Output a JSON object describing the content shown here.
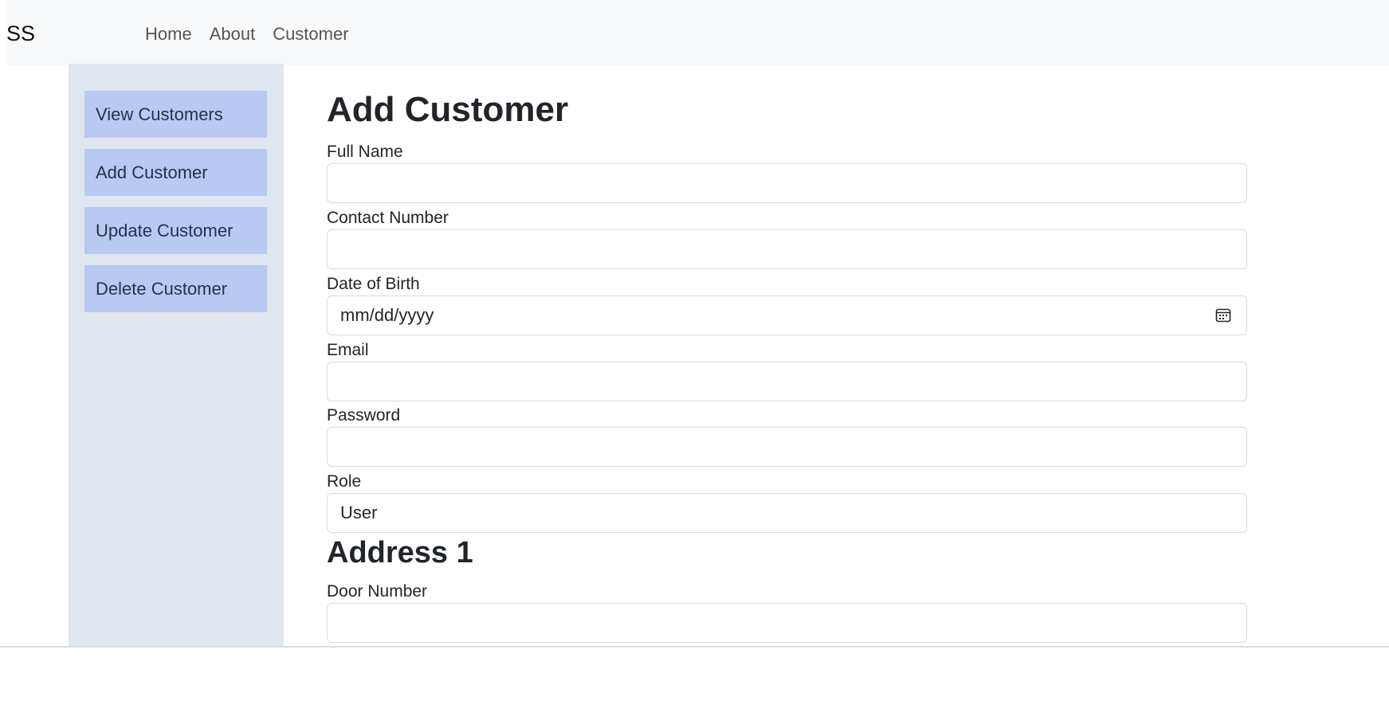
{
  "brand": "SS",
  "nav": {
    "links": [
      "Home",
      "About",
      "Customer"
    ]
  },
  "sidebar": {
    "items": [
      "View Customers",
      "Add Customer",
      "Update Customer",
      "Delete Customer"
    ]
  },
  "form": {
    "title": "Add Customer",
    "full_name_label": "Full Name",
    "contact_label": "Contact Number",
    "dob_label": "Date of Birth",
    "dob_placeholder": "mm/dd/yyyy",
    "email_label": "Email",
    "password_label": "Password",
    "role_label": "Role",
    "role_value": "User",
    "address_title": "Address 1",
    "door_label": "Door Number"
  },
  "icons": {
    "calendar": "calendar-icon"
  }
}
